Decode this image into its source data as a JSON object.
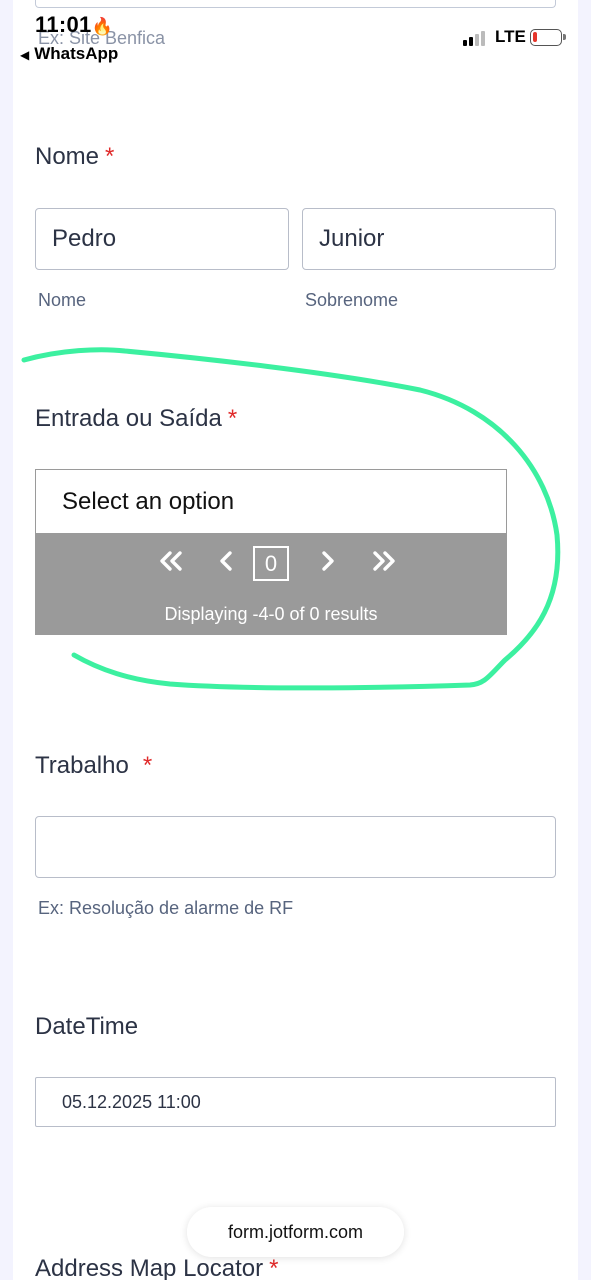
{
  "status_bar": {
    "time": "11:01",
    "back_app": "WhatsApp",
    "network": "LTE"
  },
  "form": {
    "prev_hint": "Ex: Site Benfica",
    "name_field": {
      "label": "Nome",
      "required_mark": "*",
      "first_value": "Pedro",
      "last_value": "Junior",
      "first_sublabel": "Nome",
      "last_sublabel": "Sobrenome"
    },
    "entry_exit": {
      "label": "Entrada ou Saída",
      "required_mark": "*",
      "select_placeholder": "Select an option",
      "pager": {
        "first_icon": "double-chevron-left-icon",
        "prev_icon": "chevron-left-icon",
        "page_number": "0",
        "next_icon": "chevron-right-icon",
        "last_icon": "double-chevron-right-icon",
        "info": "Displaying -4-0 of 0 results"
      }
    },
    "work": {
      "label": "Trabalho",
      "required_mark": "*",
      "value": "",
      "hint": "Ex: Resolução de alarme de RF"
    },
    "datetime": {
      "label": "DateTime",
      "value": "05.12.2025 11:00"
    },
    "address": {
      "label": "Address Map Locator",
      "required_mark": "*"
    }
  },
  "browser": {
    "url": "form.jotform.com"
  },
  "colors": {
    "annotation": "#3cf0a0",
    "required": "#e02a2a",
    "pager_bg": "#9a9a9a"
  }
}
